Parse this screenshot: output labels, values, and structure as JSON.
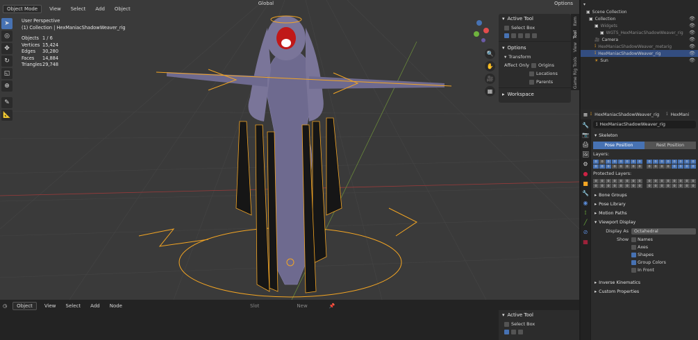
{
  "viewport": {
    "mode": "Object Mode",
    "menu": [
      "View",
      "Select",
      "Add",
      "Object"
    ],
    "orientation": "Global",
    "options_label": "Options",
    "perspective": "User Perspective",
    "collection_line": "(1) Collection | HexManiacShadowWeaver_rig",
    "stats": [
      {
        "k": "Objects",
        "v": "1 / 6"
      },
      {
        "k": "Vertices",
        "v": "15,424"
      },
      {
        "k": "Edges",
        "v": "30,280"
      },
      {
        "k": "Faces",
        "v": "14,884"
      },
      {
        "k": "Triangles",
        "v": "29,748"
      }
    ]
  },
  "npanel": {
    "active_tool_title": "Active Tool",
    "select_box": "Select Box",
    "options_title": "Options",
    "transform_title": "Transform",
    "affect_only": "Affect Only",
    "affect_items": [
      "Origins",
      "Locations",
      "Parents"
    ],
    "workspace_title": "Workspace",
    "tabs": [
      "Item",
      "Tool",
      "View",
      "Game Rig Tools"
    ]
  },
  "outliner": {
    "scene_collection": "Scene Collection",
    "rows": [
      {
        "label": "Collection",
        "indent": 1,
        "icon": "collection-icon"
      },
      {
        "label": "Widgets",
        "indent": 2,
        "icon": "collection-icon",
        "dim": true
      },
      {
        "label": "WGTS_HexManiacShadowWeaver_rig",
        "indent": 3,
        "icon": "collection-icon",
        "dim": true
      },
      {
        "label": "Camera",
        "indent": 2,
        "icon": "camera-icon"
      },
      {
        "label": "HexManiacShadowWeaver_metarig",
        "indent": 2,
        "icon": "armature-icon",
        "dim": true
      },
      {
        "label": "HexManiacShadowWeaver_rig",
        "indent": 2,
        "icon": "armature-icon",
        "sel": true
      },
      {
        "label": "Sun",
        "indent": 2,
        "icon": "light-icon"
      }
    ]
  },
  "properties": {
    "header_object": "HexManiacShadowWeaver_rig",
    "header_data": "HexMani",
    "search_value": "HexManiacShadowWeaver_rig",
    "skeleton_title": "Skeleton",
    "pose_position": "Pose Position",
    "rest_position": "Rest Position",
    "layers_label": "Layers:",
    "protected_layers_label": "Protected Layers:",
    "sections_collapsed": [
      "Bone Groups",
      "Pose Library",
      "Motion Paths"
    ],
    "viewport_display_title": "Viewport Display",
    "display_as_label": "Display As",
    "display_as_value": "Octahedral",
    "show_label": "Show",
    "show_items": [
      {
        "label": "Names",
        "on": false
      },
      {
        "label": "Axes",
        "on": false
      },
      {
        "label": "Shapes",
        "on": true
      },
      {
        "label": "Group Colors",
        "on": true
      },
      {
        "label": "In Front",
        "on": false
      }
    ],
    "sections_bottom": [
      "Inverse Kinematics",
      "Custom Properties"
    ]
  },
  "bottom_editor": {
    "mode": "Object",
    "menu": [
      "View",
      "Select",
      "Add",
      "Node"
    ],
    "slot": "Slot",
    "new": "New",
    "active_tool_title": "Active Tool",
    "select_box": "Select Box"
  },
  "colors": {
    "accent": "#4772b3",
    "armature_orange": "#f5a623",
    "selection_highlight": "#334d80"
  }
}
